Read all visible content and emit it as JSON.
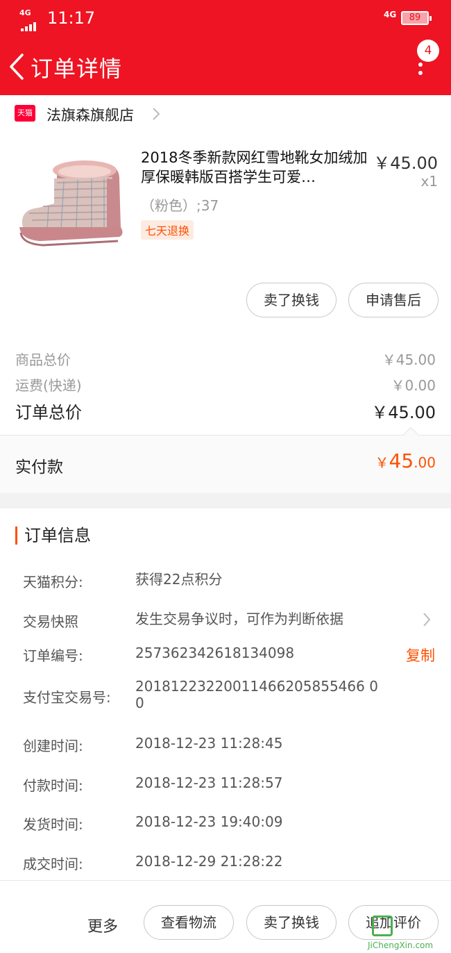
{
  "status_bar": {
    "network_left": "4G",
    "time": "11:17",
    "network_right": "4G",
    "battery": "89"
  },
  "header": {
    "title": "订单详情",
    "notification_count": "4"
  },
  "shop": {
    "icon_label": "天猫",
    "name": "法旗森旗舰店"
  },
  "product": {
    "title": "2018冬季新款网红雪地靴女加绒加厚保暖韩版百搭学生可爱…",
    "price": "￥45.00",
    "quantity": "x1",
    "sku": "（粉色）;37",
    "return_tag": "七天退换",
    "buttons": [
      "卖了换钱",
      "申请售后"
    ]
  },
  "summary": {
    "goods_total_label": "商品总价",
    "goods_total_value": "￥45.00",
    "shipping_label": "运费(快递)",
    "shipping_value": "￥0.00",
    "order_total_label": "订单总价",
    "order_total_value": "￥45.00",
    "paid_label": "实付款",
    "paid_currency": "￥",
    "paid_int": "45",
    "paid_dec": ".00"
  },
  "order_info": {
    "heading": "订单信息",
    "rows": [
      {
        "label": "天猫积分:",
        "value": "获得22点积分"
      },
      {
        "label": "交易快照",
        "value": "发生交易争议时，可作为判断依据"
      },
      {
        "label": "订单编号:",
        "value": "257362342618134098"
      },
      {
        "label": "支付宝交易号:",
        "value": "20181223220011466205855466 00"
      },
      {
        "label": "创建时间:",
        "value": "2018-12-23 11:28:45"
      },
      {
        "label": "付款时间:",
        "value": "2018-12-23 11:28:57"
      },
      {
        "label": "发货时间:",
        "value": "2018-12-23 19:40:09"
      },
      {
        "label": "成交时间:",
        "value": "2018-12-29 21:28:22"
      }
    ],
    "copy_label": "复制"
  },
  "bottom_bar": {
    "more": "更多",
    "buttons": [
      "查看物流",
      "卖了换钱",
      "追加评价"
    ]
  },
  "watermark": {
    "text": "JiChengXin.com"
  },
  "colors": {
    "header_red": "#ee1423",
    "accent_orange": "#ff5000"
  }
}
